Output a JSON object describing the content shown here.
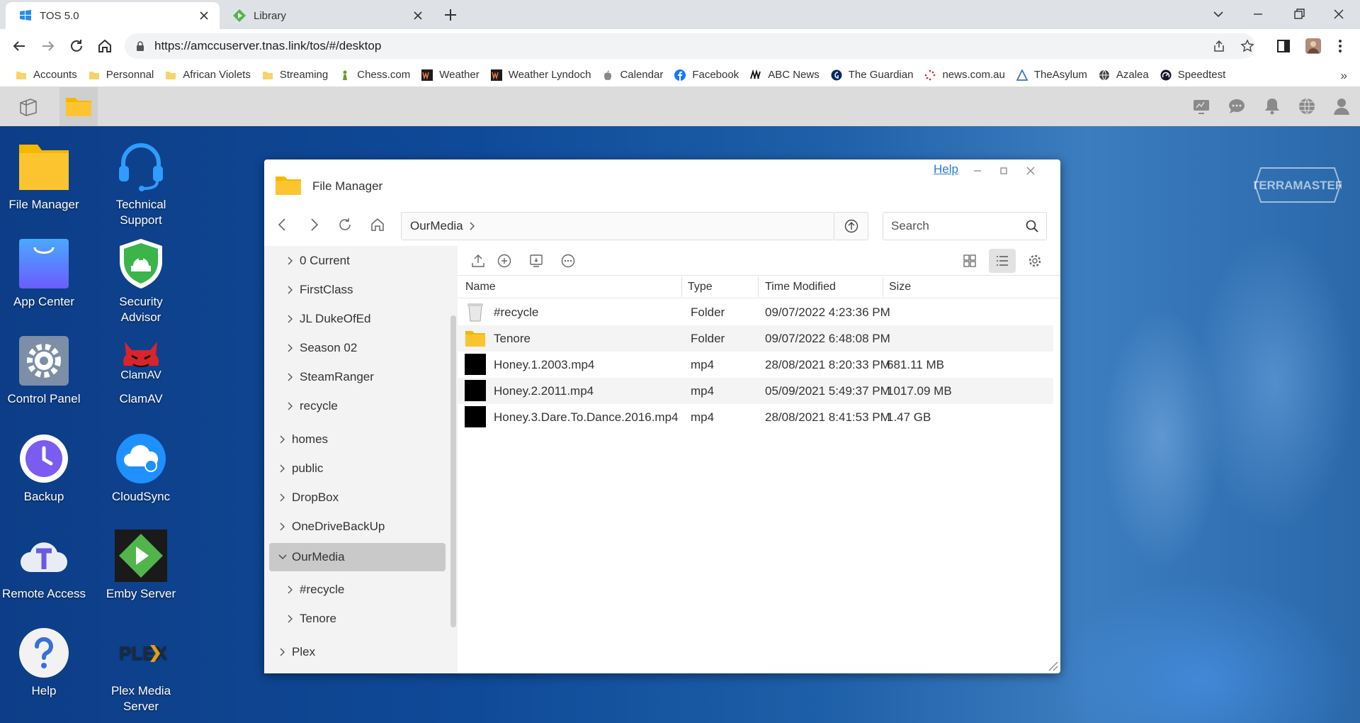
{
  "browser": {
    "tabs": [
      {
        "title": "TOS 5.0",
        "active": true,
        "icon": "windows-icon"
      },
      {
        "title": "Library",
        "active": false,
        "icon": "emby-icon"
      }
    ],
    "url": "https://amccuserver.tnas.link/tos/#/desktop",
    "bookmarks": [
      {
        "label": "Accounts",
        "icon": "folder-icon"
      },
      {
        "label": "Personnal",
        "icon": "folder-icon"
      },
      {
        "label": "African Violets",
        "icon": "folder-icon"
      },
      {
        "label": "Streaming",
        "icon": "folder-icon"
      },
      {
        "label": "Chess.com",
        "icon": "chess-pawn-icon"
      },
      {
        "label": "Weather",
        "icon": "wu-icon"
      },
      {
        "label": "Weather Lyndoch",
        "icon": "wu-icon"
      },
      {
        "label": "Calendar",
        "icon": "apple-icon"
      },
      {
        "label": "Facebook",
        "icon": "facebook-icon"
      },
      {
        "label": "ABC News",
        "icon": "abc-icon"
      },
      {
        "label": "The Guardian",
        "icon": "guardian-icon"
      },
      {
        "label": "news.com.au",
        "icon": "newscom-icon"
      },
      {
        "label": "TheAsylum",
        "icon": "triangle-icon"
      },
      {
        "label": "Azalea",
        "icon": "globe-icon"
      },
      {
        "label": "Speedtest",
        "icon": "speedtest-icon"
      }
    ],
    "more": "»"
  },
  "desktop": {
    "icons": [
      {
        "label": "File Manager",
        "icon": "file-manager-icon"
      },
      {
        "label": "Technical\nSupport",
        "icon": "headset-icon"
      },
      {
        "label": "App Center",
        "icon": "shopping-bag-icon"
      },
      {
        "label": "Security\nAdvisor",
        "icon": "shield-icon"
      },
      {
        "label": "Control Panel",
        "icon": "gear-icon"
      },
      {
        "label": "ClamAV",
        "icon": "clamav-icon"
      },
      {
        "label": "Backup",
        "icon": "backup-clock-icon"
      },
      {
        "label": "CloudSync",
        "icon": "cloud-sync-icon"
      },
      {
        "label": "Remote Access",
        "icon": "remote-access-icon"
      },
      {
        "label": "Emby Server",
        "icon": "emby-icon"
      },
      {
        "label": "Help",
        "icon": "help-icon"
      },
      {
        "label": "Plex Media\nServer",
        "icon": "plex-icon"
      }
    ],
    "watermark": "TERRAMASTER",
    "clamav_logo_text": "ClamAV",
    "plex_logo_text": "PLEX"
  },
  "file_manager": {
    "title": "File Manager",
    "help": "Help",
    "breadcrumb": "OurMedia",
    "search_placeholder": "Search",
    "tree": [
      {
        "label": "0 Current",
        "level": 1,
        "expanded": false
      },
      {
        "label": "FirstClass",
        "level": 1,
        "expanded": false
      },
      {
        "label": "JL DukeOfEd",
        "level": 1,
        "expanded": false
      },
      {
        "label": "Season 02",
        "level": 1,
        "expanded": false
      },
      {
        "label": "SteamRanger",
        "level": 1,
        "expanded": false
      },
      {
        "label": "recycle",
        "level": 1,
        "expanded": false
      },
      {
        "label": "homes",
        "level": 0,
        "expanded": false
      },
      {
        "label": "public",
        "level": 0,
        "expanded": false
      },
      {
        "label": "DropBox",
        "level": 0,
        "expanded": false
      },
      {
        "label": "OneDriveBackUp",
        "level": 0,
        "expanded": false
      },
      {
        "label": "OurMedia",
        "level": 0,
        "expanded": true,
        "selected": true
      },
      {
        "label": "#recycle",
        "level": 1,
        "expanded": false
      },
      {
        "label": "Tenore",
        "level": 1,
        "expanded": false
      },
      {
        "label": "Plex",
        "level": 0,
        "expanded": false
      }
    ],
    "columns": [
      "Name",
      "Type",
      "Time Modified",
      "Size"
    ],
    "files": [
      {
        "name": "#recycle",
        "type": "Folder",
        "modified": "09/07/2022 4:23:36 PM",
        "size": "",
        "icon": "recycle-bin-icon"
      },
      {
        "name": "Tenore",
        "type": "Folder",
        "modified": "09/07/2022 6:48:08 PM",
        "size": "",
        "icon": "folder-icon"
      },
      {
        "name": "Honey.1.2003.mp4",
        "type": "mp4",
        "modified": "28/08/2021 8:20:33 PM",
        "size": "681.11 MB",
        "icon": "video-thumbnail-icon"
      },
      {
        "name": "Honey.2.2011.mp4",
        "type": "mp4",
        "modified": "05/09/2021 5:49:37 PM",
        "size": "1017.09 MB",
        "icon": "video-thumbnail-icon"
      },
      {
        "name": "Honey.3.Dare.To.Dance.2016.mp4",
        "type": "mp4",
        "modified": "28/08/2021 8:41:53 PM",
        "size": "1.47 GB",
        "icon": "video-thumbnail-icon"
      }
    ]
  },
  "colors": {
    "folder": "#f9c22e",
    "link": "#2a7ad5",
    "desktop_bg": "#0f4a98",
    "tosbar": "#dcdcdc"
  }
}
